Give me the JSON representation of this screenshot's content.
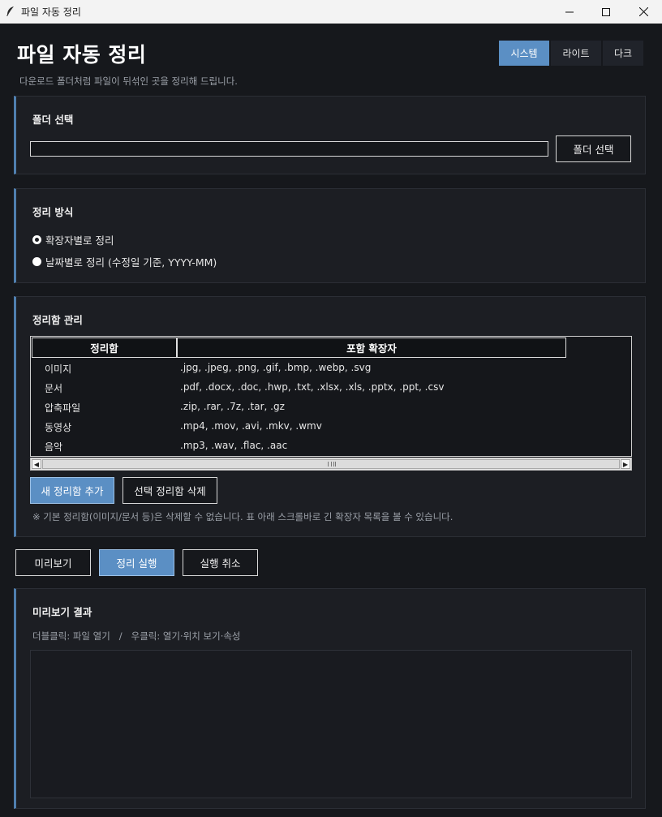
{
  "window": {
    "title": "파일 자동 정리"
  },
  "header": {
    "title": "파일 자동 정리",
    "subtitle": "다운로드 폴더처럼 파일이 뒤섞인 곳을 정리해 드립니다.",
    "theme_buttons": [
      {
        "label": "시스템",
        "active": true
      },
      {
        "label": "라이트",
        "active": false
      },
      {
        "label": "다크",
        "active": false
      }
    ]
  },
  "folder_panel": {
    "title": "폴더 선택",
    "path_value": "",
    "select_button": "폴더 선택"
  },
  "method_panel": {
    "title": "정리 방식",
    "options": [
      {
        "label": "확장자별로 정리",
        "checked": true
      },
      {
        "label": "날짜별로 정리 (수정일 기준, YYYY-MM)",
        "checked": false
      }
    ]
  },
  "bins_panel": {
    "title": "정리함 관리",
    "columns": [
      "정리함",
      "포함 확장자"
    ],
    "rows": [
      {
        "name": "이미지",
        "exts": ".jpg, .jpeg, .png, .gif, .bmp, .webp, .svg"
      },
      {
        "name": "문서",
        "exts": ".pdf, .docx, .doc, .hwp, .txt, .xlsx, .xls, .pptx, .ppt, .csv"
      },
      {
        "name": "압축파일",
        "exts": ".zip, .rar, .7z, .tar, .gz"
      },
      {
        "name": "동영상",
        "exts": ".mp4, .mov, .avi, .mkv, .wmv"
      },
      {
        "name": "음악",
        "exts": ".mp3, .wav, .flac, .aac"
      }
    ],
    "add_button": "새 정리함 추가",
    "delete_button": "선택 정리함 삭제",
    "note": "※ 기본 정리함(이미지/문서 등)은 삭제할 수 없습니다. 표 아래 스크롤바로 긴 확장자 목록을 볼 수 있습니다."
  },
  "actions": {
    "preview": "미리보기",
    "run": "정리 실행",
    "undo": "실행 취소"
  },
  "result_panel": {
    "title": "미리보기 결과",
    "hint": "더블클릭: 파일 열기   /   우클릭: 열기·위치 보기·속성"
  },
  "colors": {
    "accent": "#5b8fc4",
    "background": "#16181c",
    "panel": "#1c1e23"
  }
}
